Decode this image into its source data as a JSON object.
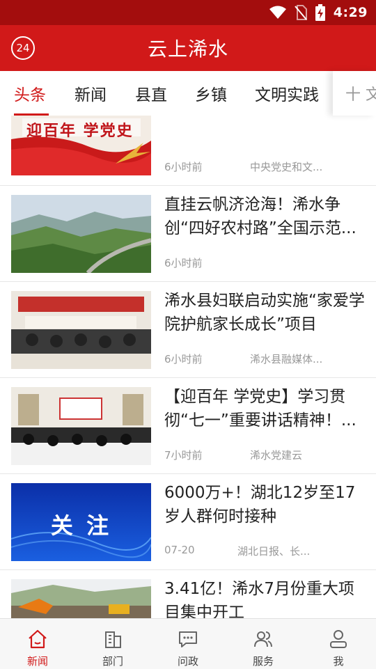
{
  "status": {
    "time": "4:29"
  },
  "appbar": {
    "badge": "24",
    "title": "云上浠水"
  },
  "tabs": [
    {
      "label": "头条",
      "active": true
    },
    {
      "label": "新闻"
    },
    {
      "label": "县直"
    },
    {
      "label": "乡镇"
    },
    {
      "label": "文明实践"
    }
  ],
  "tab_add": {
    "label": "十 文"
  },
  "feed": [
    {
      "title": "",
      "time": "6小时前",
      "source": "中央党史和文...",
      "banner_text": "迎百年 学党史"
    },
    {
      "title": "直挂云帆济沧海！浠水争创“四好农村路”全国示范...",
      "time": "6小时前",
      "source": ""
    },
    {
      "title": "浠水县妇联启动实施“家爱学院护航家长成长”项目",
      "time": "6小时前",
      "source": "浠水县融媒体..."
    },
    {
      "title": "【迎百年 学党史】学习贯彻“七一”重要讲话精神！...",
      "time": "7小时前",
      "source": "浠水党建云"
    },
    {
      "title": "6000万+！湖北12岁至17岁人群何时接种",
      "time": "07-20",
      "source": "湖北日报、长...",
      "banner_text": "关 注"
    },
    {
      "title": "3.41亿！浠水7月份重大项目集中开工",
      "time": "",
      "source": ""
    }
  ],
  "bottom_nav": [
    {
      "label": "新闻",
      "icon": "home-icon",
      "active": true
    },
    {
      "label": "部门",
      "icon": "building-icon"
    },
    {
      "label": "问政",
      "icon": "chat-icon"
    },
    {
      "label": "服务",
      "icon": "people-icon"
    },
    {
      "label": "我",
      "icon": "person-icon"
    }
  ],
  "colors": {
    "primary": "#d11919",
    "status_bar": "#a30d0d",
    "meta_text": "#999999"
  }
}
